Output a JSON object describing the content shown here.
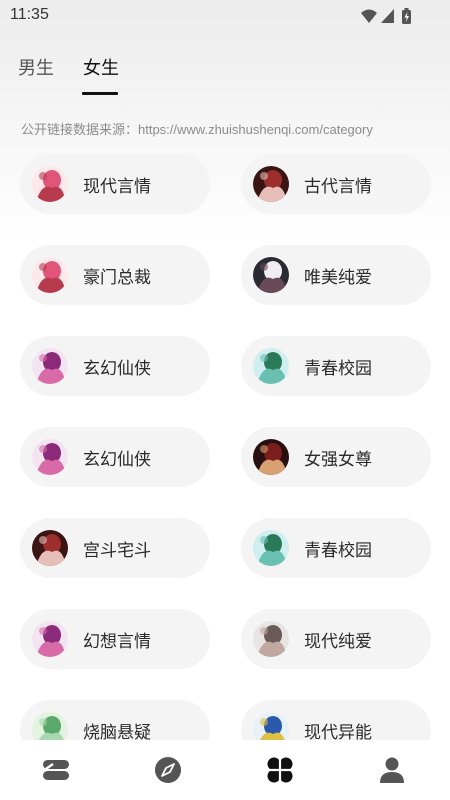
{
  "status_bar": {
    "time": "11:35",
    "icons": [
      "wifi-icon",
      "cellular-signal-icon",
      "battery-icon"
    ]
  },
  "tabs": [
    {
      "label": "男生",
      "active": false
    },
    {
      "label": "女生",
      "active": true
    }
  ],
  "source_note": "公开链接数据来源：https://www.zhuishushenqi.com/category",
  "categories": [
    {
      "label": "现代言情",
      "cover": "cover-pink-girl"
    },
    {
      "label": "古代言情",
      "cover": "cover-red-couple"
    },
    {
      "label": "豪门总裁",
      "cover": "cover-pink-girl"
    },
    {
      "label": "唯美纯爱",
      "cover": "cover-dark-couple"
    },
    {
      "label": "玄幻仙侠",
      "cover": "cover-purple-girl"
    },
    {
      "label": "青春校园",
      "cover": "cover-teal-calligraphy"
    },
    {
      "label": "玄幻仙侠",
      "cover": "cover-purple-girl"
    },
    {
      "label": "女强女尊",
      "cover": "cover-dark-red"
    },
    {
      "label": "宫斗宅斗",
      "cover": "cover-red-couple"
    },
    {
      "label": "青春校园",
      "cover": "cover-teal-calligraphy"
    },
    {
      "label": "幻想言情",
      "cover": "cover-purple-girl"
    },
    {
      "label": "现代纯爱",
      "cover": "cover-grey-couple"
    },
    {
      "label": "烧脑悬疑",
      "cover": "cover-green-girl"
    },
    {
      "label": "现代异能",
      "cover": "cover-blue-text"
    }
  ],
  "bottom_nav": [
    {
      "icon": "stack-icon",
      "active": false
    },
    {
      "icon": "compass-icon",
      "active": false
    },
    {
      "icon": "clover-icon",
      "active": true
    },
    {
      "icon": "profile-icon",
      "active": false
    }
  ],
  "colors": {
    "pill_background": "#f4f4f4",
    "active_tab_indicator": "#111111",
    "nav_inactive": "#555555",
    "nav_active": "#111111"
  }
}
